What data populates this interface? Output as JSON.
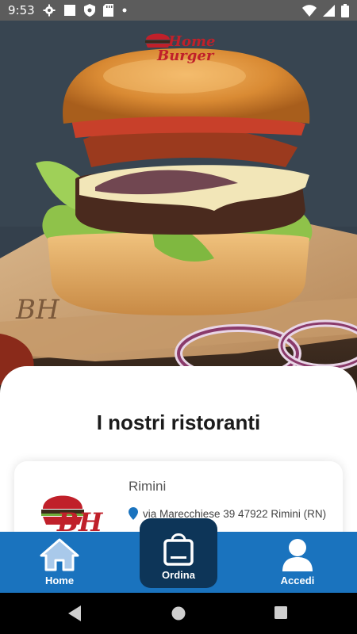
{
  "status_bar": {
    "time": "9:53",
    "left_icons": [
      "gear-icon",
      "square-icon",
      "shield-icon",
      "sd-card-icon",
      "dot-icon"
    ],
    "right_icons": [
      "wifi-icon",
      "signal-icon",
      "battery-icon"
    ]
  },
  "hero": {
    "logo_line1": "Home",
    "logo_line2": "Burger",
    "wrapper_monogram": "BH"
  },
  "content": {
    "section_title": "I nostri ristoranti",
    "restaurants": [
      {
        "name": "Rimini",
        "address": "via Marecchiese 39 47922 Rimini (RN)",
        "logo_monogram": "BH"
      }
    ]
  },
  "bottom_nav": {
    "items": [
      {
        "label": "Home",
        "icon": "house-icon"
      },
      {
        "label": "Ordina",
        "icon": "shopping-bag-icon"
      },
      {
        "label": "Accedi",
        "icon": "user-icon"
      }
    ]
  },
  "colors": {
    "nav_bar": "#1a73be",
    "nav_active": "#0d3558",
    "status_bar": "#5c5c5c",
    "logo_red": "#c0202a",
    "pin_blue": "#1a73be"
  }
}
